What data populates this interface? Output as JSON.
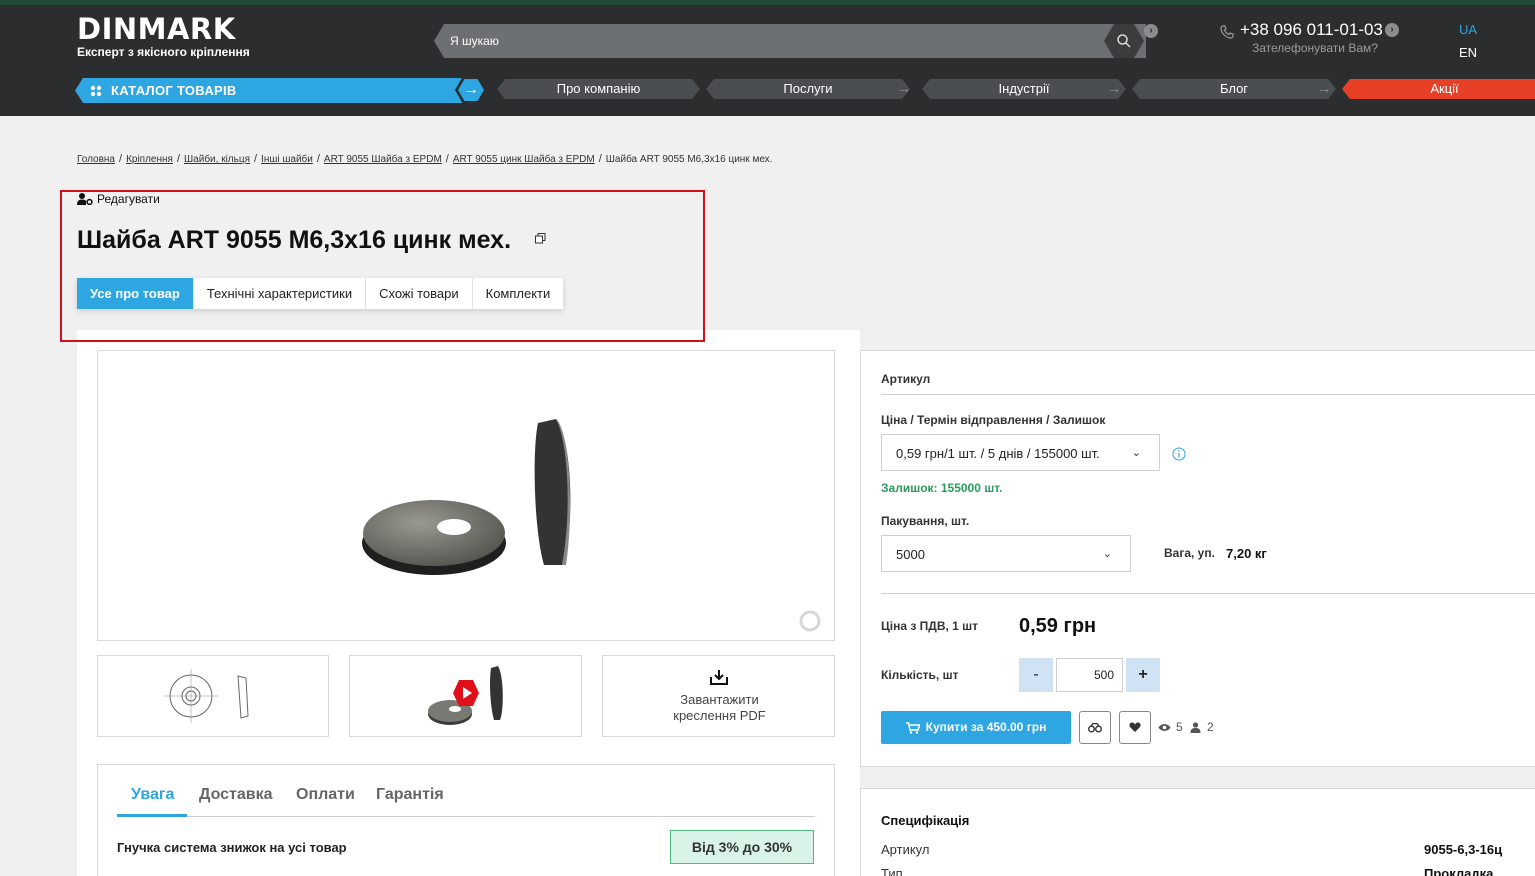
{
  "header": {
    "logo_text": "DINMARK",
    "logo_tagline": "Експерт з якісного кріплення",
    "search_placeholder": "Я шукаю",
    "phone": "+38 096 011-01-03",
    "callback": "Зателефонувати Вам?",
    "lang_ua": "UA",
    "lang_en": "EN",
    "catalog": "КАТАЛОГ ТОВАРІВ",
    "nav": [
      "Про компанію",
      "Послуги",
      "Індустрії",
      "Блог",
      "Акції"
    ]
  },
  "breadcrumb": {
    "items": [
      "Головна",
      "Кріплення",
      "Шайби, кільця",
      "Інші шайби",
      "ART 9055 Шайба з EPDM",
      "ART 9055 цинк Шайба з EPDM"
    ],
    "current": "Шайба ART 9055 М6,3х16 цинк мех."
  },
  "product": {
    "edit": "Редагувати",
    "title": "Шайба ART 9055 М6,3х16 цинк мех.",
    "tabs": [
      "Усе про товар",
      "Технічні характеристики",
      "Схожі товари",
      "Комплекти"
    ],
    "download_line1": "Завантажити",
    "download_line2": "креслення PDF"
  },
  "info_tabs": [
    "Увага",
    "Доставка",
    "Оплати",
    "Гарантія"
  ],
  "discount": {
    "text": "Гнучка система знижок на усі товар",
    "badge": "Від 3% до 30%"
  },
  "order": {
    "article_label": "Артикул",
    "price_term_label": "Ціна / Термін відправлення / Залишок",
    "price_term_value": "0,59 грн/1 шт. / 5 днів / 155000 шт.",
    "stock": "Залишок: 155000 шт.",
    "packing_label": "Пакування, шт.",
    "packing_value": "5000",
    "weight_label": "Вага, уп.",
    "weight_value": "7,20 кг",
    "price_label": "Ціна з ПДВ, 1 шт",
    "price_value": "0,59 грн",
    "qty_label": "Кількість, шт",
    "qty_minus": "-",
    "qty_value": "500",
    "qty_plus": "+",
    "buy": "Купити за 450.00 грн",
    "views": "5",
    "users": "2"
  },
  "spec": {
    "title": "Специфікація",
    "rows": [
      {
        "label": "Артикул",
        "value": "9055-6,3-16ц"
      },
      {
        "label": "Тип",
        "value": "Прокладка"
      }
    ]
  }
}
